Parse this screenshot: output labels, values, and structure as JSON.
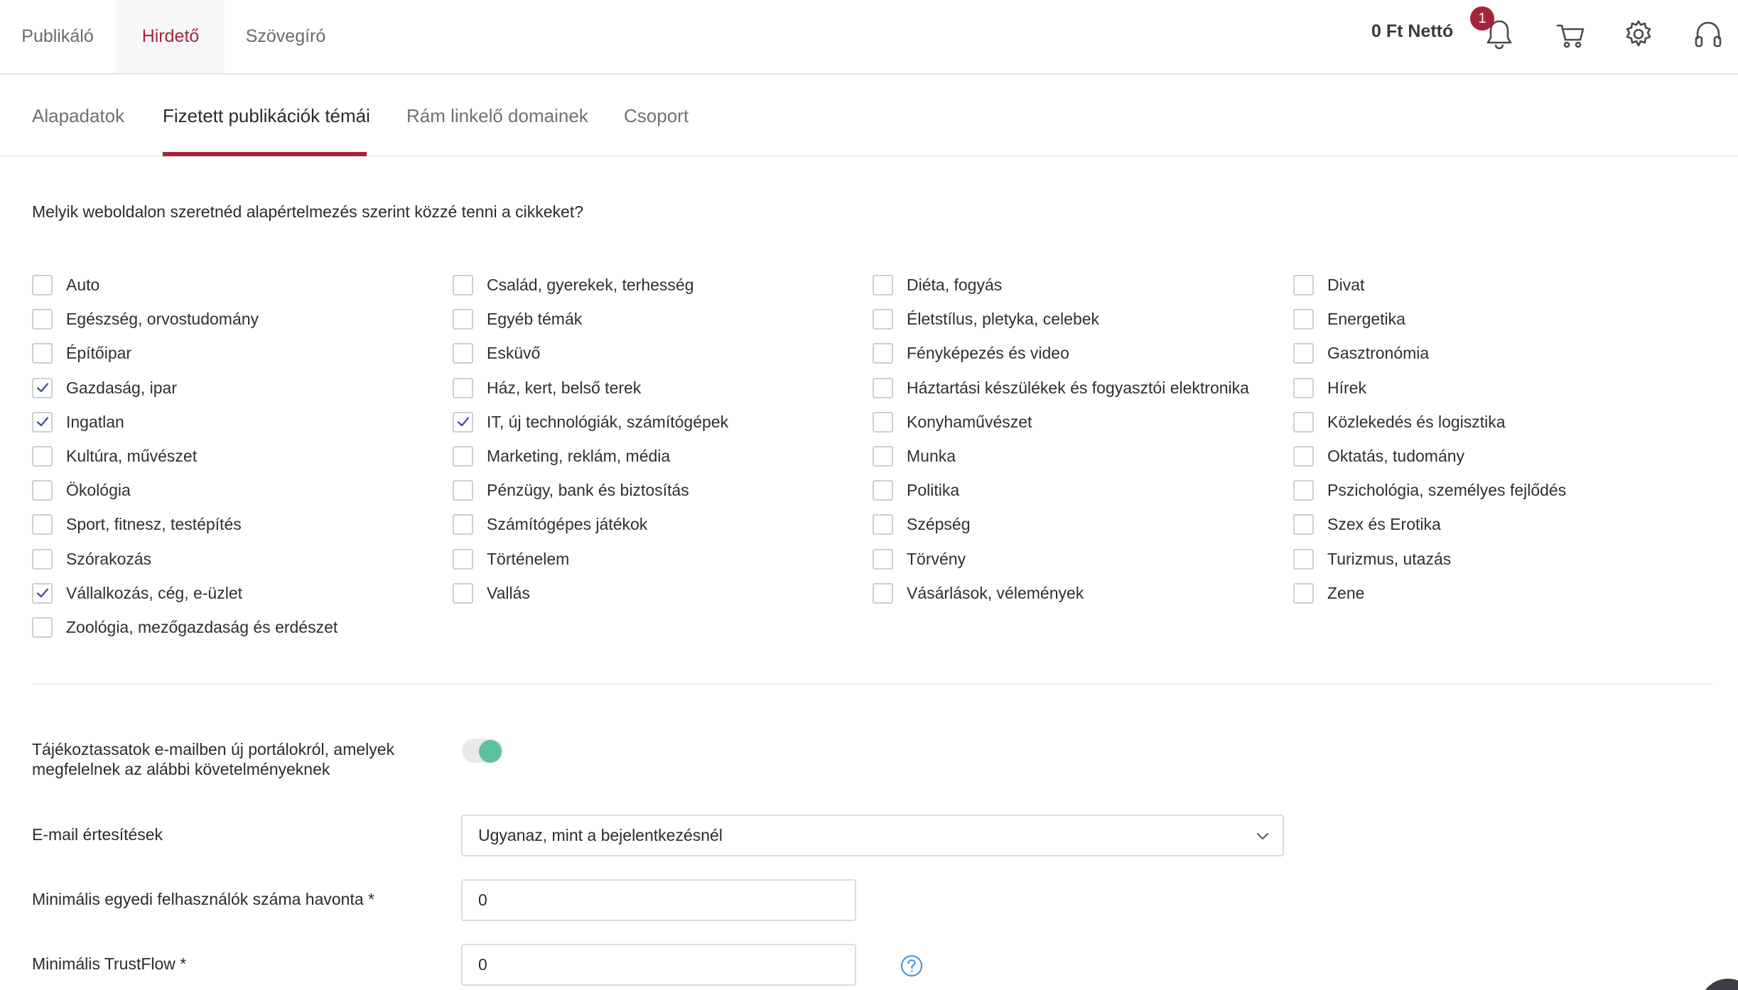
{
  "role_tabs": [
    {
      "label": "Publikáló",
      "active": false
    },
    {
      "label": "Hirdető",
      "active": true
    },
    {
      "label": "Szövegíró",
      "active": false
    }
  ],
  "header": {
    "balance": "0 Ft Nettó",
    "notification_count": "1",
    "icons": [
      "bell-icon",
      "cart-icon",
      "gear-icon",
      "headphones-icon"
    ]
  },
  "subtabs": [
    {
      "label": "Alapadatok",
      "active": false
    },
    {
      "label": "Fizetett publikációk témái",
      "active": true
    },
    {
      "label": "Rám linkelő domainek",
      "active": false
    },
    {
      "label": "Csoport",
      "active": false
    }
  ],
  "question": "Melyik weboldalon szeretnéd alapértelmezés szerint közzé tenni a cikkeket?",
  "topics": {
    "col1": [
      {
        "label": "Auto",
        "checked": false
      },
      {
        "label": "Egészség, orvostudomány",
        "checked": false
      },
      {
        "label": "Építőipar",
        "checked": false
      },
      {
        "label": "Gazdaság, ipar",
        "checked": true
      },
      {
        "label": "Ingatlan",
        "checked": true
      },
      {
        "label": "Kultúra, művészet",
        "checked": false
      },
      {
        "label": "Ökológia",
        "checked": false
      },
      {
        "label": "Sport, fitnesz, testépítés",
        "checked": false
      },
      {
        "label": "Szórakozás",
        "checked": false
      },
      {
        "label": "Vállalkozás, cég, e-üzlet",
        "checked": true
      },
      {
        "label": "Zoológia, mezőgazdaság és erdészet",
        "checked": false
      }
    ],
    "col2": [
      {
        "label": "Család, gyerekek, terhesség",
        "checked": false
      },
      {
        "label": "Egyéb témák",
        "checked": false
      },
      {
        "label": "Esküvő",
        "checked": false
      },
      {
        "label": "Ház, kert, belső terek",
        "checked": false
      },
      {
        "label": "IT, új technológiák, számítógépek",
        "checked": true
      },
      {
        "label": "Marketing, reklám, média",
        "checked": false
      },
      {
        "label": "Pénzügy, bank és biztosítás",
        "checked": false
      },
      {
        "label": "Számítógépes játékok",
        "checked": false
      },
      {
        "label": "Történelem",
        "checked": false
      },
      {
        "label": "Vallás",
        "checked": false
      }
    ],
    "col3": [
      {
        "label": "Diéta, fogyás",
        "checked": false
      },
      {
        "label": "Életstílus, pletyka, celebek",
        "checked": false
      },
      {
        "label": "Fényképezés és video",
        "checked": false
      },
      {
        "label": "Háztartási készülékek és fogyasztói elektronika",
        "checked": false
      },
      {
        "label": "Konyhaművészet",
        "checked": false
      },
      {
        "label": "Munka",
        "checked": false
      },
      {
        "label": "Politika",
        "checked": false
      },
      {
        "label": "Szépség",
        "checked": false
      },
      {
        "label": "Törvény",
        "checked": false
      },
      {
        "label": "Vásárlások, vélemények",
        "checked": false
      }
    ],
    "col4": [
      {
        "label": "Divat",
        "checked": false
      },
      {
        "label": "Energetika",
        "checked": false
      },
      {
        "label": "Gasztronómia",
        "checked": false
      },
      {
        "label": "Hírek",
        "checked": false
      },
      {
        "label": "Közlekedés és logisztika",
        "checked": false
      },
      {
        "label": "Oktatás, tudomány",
        "checked": false
      },
      {
        "label": "Pszichológia, személyes fejlődés",
        "checked": false
      },
      {
        "label": "Szex és Erotika",
        "checked": false
      },
      {
        "label": "Turizmus, utazás",
        "checked": false
      },
      {
        "label": "Zene",
        "checked": false
      }
    ]
  },
  "form": {
    "newsletter_label_line1": "Tájékoztassatok e-mailben új portálokról, amelyek",
    "newsletter_label_line2": "megfelelnek az alábbi követelményeknek",
    "newsletter_enabled": true,
    "email_label": "E-mail értesítések",
    "email_value": "Ugyanaz, mint a bejelentkezésnél",
    "min_users_label": "Minimális egyedi felhasználók száma havonta *",
    "min_users_value": "0",
    "min_trustflow_label": "Minimális TrustFlow *",
    "min_trustflow_value": "0"
  },
  "colors": {
    "accent": "#a8233a",
    "toggle_on": "#5cc0a0",
    "help": "#3b8fd9"
  }
}
